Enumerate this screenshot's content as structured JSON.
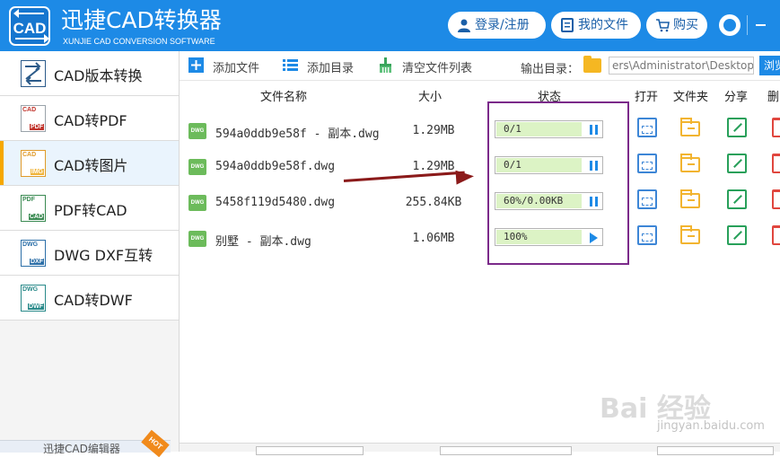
{
  "header": {
    "title": "迅捷CAD转换器",
    "subtitle": "XUNJIE CAD CONVERSION SOFTWARE",
    "logo_text": "CAD",
    "login_label": "登录/注册",
    "myfiles_label": "我的文件",
    "buy_label": "购买"
  },
  "sidebar": {
    "items": [
      {
        "label": "CAD版本转换",
        "icon": "cad-version-convert-icon",
        "active": false
      },
      {
        "label": "CAD转PDF",
        "icon": "cad-to-pdf-icon",
        "active": false
      },
      {
        "label": "CAD转图片",
        "icon": "cad-to-image-icon",
        "active": true
      },
      {
        "label": "PDF转CAD",
        "icon": "pdf-to-cad-icon",
        "active": false
      },
      {
        "label": "DWG DXF互转",
        "icon": "dwg-dxf-convert-icon",
        "active": false
      },
      {
        "label": "CAD转DWF",
        "icon": "cad-to-dwf-icon",
        "active": false
      }
    ],
    "promo_text": "迅捷CAD编辑器",
    "promo_badge": "HOT"
  },
  "toolbar": {
    "add_file": "添加文件",
    "add_dir": "添加目录",
    "clear_list": "清空文件列表",
    "output_label": "输出目录：",
    "output_path": "ers\\Administrator\\Desktop",
    "browse_label": "浏览"
  },
  "table": {
    "headers": {
      "name": "文件名称",
      "size": "大小",
      "status": "状态",
      "open": "打开",
      "folder": "文件夹",
      "share": "分享",
      "delete": "删除"
    },
    "rows": [
      {
        "name": "594a0ddb9e58f - 副本.dwg",
        "size": "1.29MB",
        "status": "0/1",
        "progress": 1.0,
        "control": "pause"
      },
      {
        "name": "594a0ddb9e58f.dwg",
        "size": "1.29MB",
        "status": "0/1",
        "progress": 1.0,
        "control": "pause"
      },
      {
        "name": "5458f119d5480.dwg",
        "size": "255.84KB",
        "status": "60%/0.00KB",
        "progress": 1.0,
        "control": "pause"
      },
      {
        "name": "别墅 - 副本.dwg",
        "size": "1.06MB",
        "status": "100%",
        "progress": 1.0,
        "control": "play"
      }
    ]
  },
  "watermark": {
    "main": "Bai 经验",
    "sub": "jingyan.baidu.com"
  },
  "colors": {
    "header_bg": "#1d8ae6",
    "active_accent": "#f6a800",
    "progress_fill": "#dcf3c5",
    "highlight_box": "#7b2a8a",
    "arrow": "#8b1a1a"
  }
}
